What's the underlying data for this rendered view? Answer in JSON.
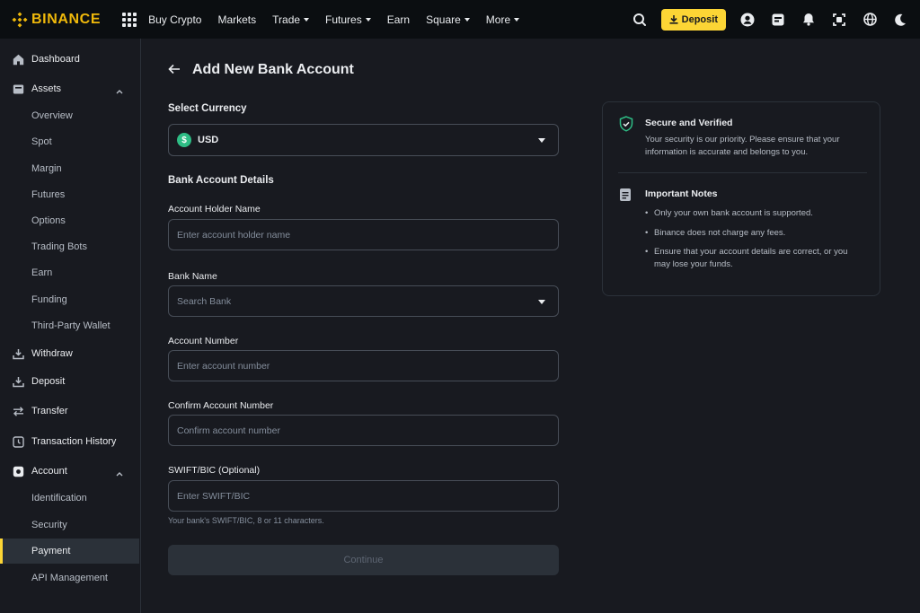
{
  "brand": {
    "name": "BINANCE",
    "color": "#F0B90B"
  },
  "topnav": {
    "items": [
      {
        "label": "Buy Crypto",
        "dropdown": false
      },
      {
        "label": "Markets",
        "dropdown": false
      },
      {
        "label": "Trade",
        "dropdown": true
      },
      {
        "label": "Futures",
        "dropdown": true
      },
      {
        "label": "Earn",
        "dropdown": false
      },
      {
        "label": "Square",
        "dropdown": true
      },
      {
        "label": "More",
        "dropdown": true
      }
    ],
    "deposit_label": "Deposit",
    "right_icons": [
      "search-icon",
      "user-icon",
      "orders-icon",
      "bell-icon",
      "download-icon",
      "globe-icon",
      "theme-icon"
    ]
  },
  "sidebar": {
    "items": [
      {
        "label": "Dashboard",
        "icon": "home-icon",
        "level": 0
      },
      {
        "label": "Assets",
        "icon": "wallet-icon",
        "level": 0,
        "expanded": true
      },
      {
        "label": "Overview",
        "level": 1
      },
      {
        "label": "Spot",
        "level": 1
      },
      {
        "label": "Margin",
        "level": 1
      },
      {
        "label": "Futures",
        "level": 1
      },
      {
        "label": "Options",
        "level": 1
      },
      {
        "label": "Trading Bots",
        "level": 1
      },
      {
        "label": "Earn",
        "level": 1
      },
      {
        "label": "Funding",
        "level": 1
      },
      {
        "label": "Third-Party Wallet",
        "level": 1
      },
      {
        "label": "Withdraw",
        "icon": "withdraw-icon",
        "level": 0
      },
      {
        "label": "Deposit",
        "icon": "deposit-icon",
        "level": 0
      },
      {
        "label": "Transfer",
        "icon": "transfer-icon",
        "level": 0
      },
      {
        "label": "Transaction History",
        "icon": "history-icon",
        "level": 0
      },
      {
        "label": "Account",
        "icon": "account-icon",
        "level": 0,
        "expanded": true
      },
      {
        "label": "Identification",
        "level": 1
      },
      {
        "label": "Security",
        "level": 1
      },
      {
        "label": "Payment",
        "level": 1,
        "active": true
      },
      {
        "label": "API Management",
        "level": 1
      }
    ]
  },
  "form": {
    "title": "Add New Bank Account",
    "currency_section": "Select Currency",
    "currency_value": "USD",
    "currency_symbol": "$",
    "details_section": "Bank Account Details",
    "holder_label": "Account Holder Name",
    "holder_placeholder": "Enter account holder name",
    "bank_label": "Bank Name",
    "bank_placeholder": "Search Bank",
    "number_label": "Account Number",
    "number_placeholder": "Enter account number",
    "confirm_label": "Confirm Account Number",
    "confirm_placeholder": "Confirm account number",
    "swift_label": "SWIFT/BIC (Optional)",
    "swift_placeholder": "Enter SWIFT/BIC",
    "swift_hint": "Your bank's SWIFT/BIC, 8 or 11 characters.",
    "continue_label": "Continue"
  },
  "info": {
    "secure_title": "Secure and Verified",
    "secure_text": "Your security is our priority. Please ensure that your information is accurate and belongs to you.",
    "notes_title": "Important Notes",
    "notes": [
      "Only your own bank account is supported.",
      "Binance does not charge any fees.",
      "Ensure that your account details are correct, or you may lose your funds."
    ]
  },
  "colors": {
    "accent": "#FCD535",
    "positive": "#2EBD85",
    "background": "#181A20",
    "topbar": "#0B0E11"
  }
}
